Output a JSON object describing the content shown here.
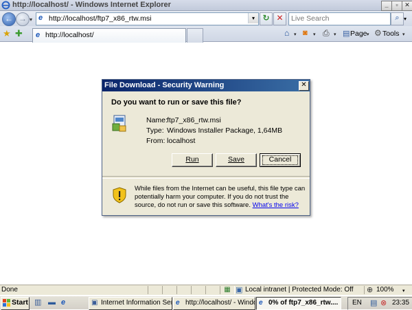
{
  "window": {
    "title": "http://localhost/ - Windows Internet Explorer"
  },
  "nav": {
    "address": "http://localhost/ftp7_x86_rtw.msi",
    "search_placeholder": "Live Search"
  },
  "tabs": {
    "active_label": "http://localhost/"
  },
  "command_bar": {
    "page_label": "Page",
    "tools_label": "Tools"
  },
  "dialog": {
    "title": "File Download - Security Warning",
    "question": "Do you want to run or save this file?",
    "name_label": "Name:",
    "name_value": "ftp7_x86_rtw.msi",
    "type_label": "Type:",
    "type_value": "Windows Installer Package, 1,64MB",
    "from_label": "From:",
    "from_value": "localhost",
    "run_label": "Run",
    "save_label": "Save",
    "cancel_label": "Cancel",
    "warning_text": "While files from the Internet can be useful, this file type can potentially harm your computer. If you do not trust the source, do not run or save this software.",
    "risk_link": "What's the risk?"
  },
  "status": {
    "text": "Done",
    "zone": "Local intranet | Protected Mode: Off",
    "zoom": "100%"
  },
  "taskbar": {
    "start_label": "Start",
    "tasks": [
      {
        "label": "Internet Information Ser..."
      },
      {
        "label": "http://localhost/ - Windo..."
      },
      {
        "label": "0% of ftp7_x86_rtw...."
      }
    ],
    "language": "EN",
    "clock": "23:35"
  }
}
